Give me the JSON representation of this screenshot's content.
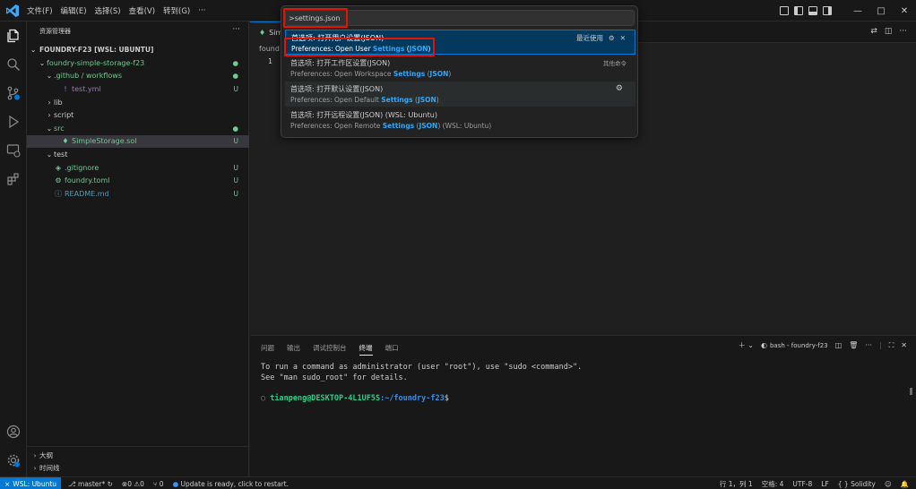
{
  "titlebar": {
    "menus": [
      "文件(F)",
      "编辑(E)",
      "选择(S)",
      "查看(V)",
      "转到(G)",
      "···"
    ],
    "window_controls": [
      "—",
      "□",
      "✕"
    ]
  },
  "sidebar": {
    "header": "资源管理器",
    "more": "···",
    "workspace": "FOUNDRY-F23 [WSL: UBUNTU]",
    "tree": [
      {
        "label": "foundry-simple-storage-f23",
        "chev": "⌄",
        "indent": 1,
        "badge": "●",
        "kind": "folder-mod"
      },
      {
        "label": ".github / workflows",
        "chev": "⌄",
        "indent": 2,
        "badge": "●",
        "kind": "folder-mod"
      },
      {
        "label": "test.yml",
        "chev": "",
        "indent": 3,
        "icon": "!",
        "badge": "U",
        "kind": "yml"
      },
      {
        "label": "lib",
        "chev": "›",
        "indent": 2,
        "badge": "",
        "kind": "folder"
      },
      {
        "label": "script",
        "chev": "›",
        "indent": 2,
        "badge": "",
        "kind": "folder"
      },
      {
        "label": "src",
        "chev": "⌄",
        "indent": 2,
        "badge": "●",
        "kind": "folder-mod"
      },
      {
        "label": "SimpleStorage.sol",
        "chev": "",
        "indent": 3,
        "icon": "♦",
        "badge": "U",
        "kind": "sol",
        "selected": true
      },
      {
        "label": "test",
        "chev": "⌄",
        "indent": 2,
        "badge": "",
        "kind": "folder"
      },
      {
        "label": ".gitignore",
        "chev": "",
        "indent": 2,
        "icon": "◈",
        "badge": "U",
        "kind": "file-mod"
      },
      {
        "label": "foundry.toml",
        "chev": "",
        "indent": 2,
        "icon": "⚙",
        "badge": "U",
        "kind": "file-mod"
      },
      {
        "label": "README.md",
        "chev": "",
        "indent": 2,
        "icon": "ⓘ",
        "badge": "U",
        "kind": "md"
      }
    ],
    "outline": [
      {
        "label": "大纲",
        "chev": "›"
      },
      {
        "label": "时间线",
        "chev": "›"
      }
    ]
  },
  "editor": {
    "tab_label": "Sim",
    "breadcrumb": "found",
    "line_number": "1",
    "tab_actions": [
      "⇄",
      "◫",
      "···"
    ]
  },
  "palette": {
    "input_value": ">settings.json",
    "items": [
      {
        "title": "首选项: 打开用户设置(JSON)",
        "sub_pre": "Preferences: Open User ",
        "sub_key": "Settings",
        "sub_mid": " (",
        "sub_key2": "JSON",
        "sub_post": ")",
        "right": "最近使用",
        "active": true
      },
      {
        "title": "首选项: 打开工作区设置(JSON)",
        "sub_pre": "Preferences: Open Workspace ",
        "sub_key": "Settings",
        "sub_mid": " (",
        "sub_key2": "JSON",
        "sub_post": ")",
        "right": "其他命令"
      },
      {
        "title": "首选项: 打开默认设置(JSON)",
        "sub_pre": "Preferences: Open Default ",
        "sub_key": "Settings",
        "sub_mid": " (",
        "sub_key2": "JSON",
        "sub_post": ")",
        "right": "",
        "hover": true
      },
      {
        "title": "首选项: 打开远程设置(JSON) (WSL: Ubuntu)",
        "sub_pre": "Preferences: Open Remote ",
        "sub_key": "Settings",
        "sub_mid": " (",
        "sub_key2": "JSON",
        "sub_post": ") (WSL: Ubuntu)",
        "right": ""
      }
    ]
  },
  "panel": {
    "tabs": [
      "问题",
      "输出",
      "调试控制台",
      "终端",
      "端口"
    ],
    "active_tab": "终端",
    "terminal_name": "bash - foundry-f23",
    "terminal_lines": [
      "To run a command as administrator (user \"root\"), use \"sudo <command>\".",
      "See \"man sudo_root\" for details."
    ],
    "prompt_user": "tianpeng@DESKTOP-4L1UF5S",
    "prompt_path": ":~/foundry-f23",
    "prompt_end": "$"
  },
  "statusbar": {
    "remote": "WSL: Ubuntu",
    "branch": "master*",
    "errors": "0",
    "warnings": "0",
    "ports": "0",
    "update": "Update is ready, click to restart.",
    "position": "行 1，列 1",
    "spaces": "空格: 4",
    "encoding": "UTF-8",
    "eol": "LF",
    "language": "Solidity"
  },
  "colors": {
    "accent": "#0078d4",
    "highlight_box": "#e51400",
    "git_untracked": "#73c991"
  }
}
